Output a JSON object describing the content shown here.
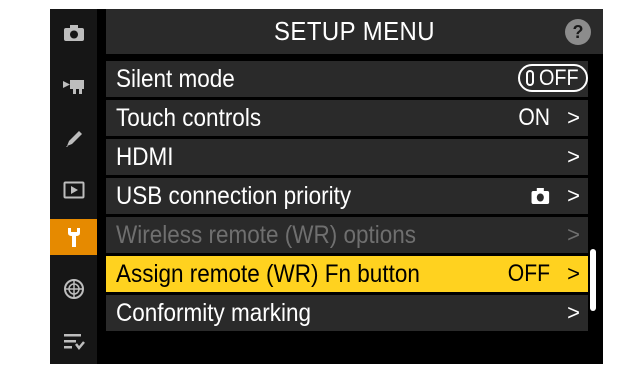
{
  "header": {
    "title": "SETUP MENU",
    "help": "?"
  },
  "sidebar": {
    "items": [
      {
        "icon": "camera-icon",
        "active": false
      },
      {
        "icon": "movie-camera-icon",
        "active": false
      },
      {
        "icon": "pencil-icon",
        "active": false
      },
      {
        "icon": "playback-icon",
        "active": false
      },
      {
        "icon": "wrench-icon",
        "active": true
      },
      {
        "icon": "network-icon",
        "active": false
      },
      {
        "icon": "my-menu-icon",
        "active": false
      }
    ]
  },
  "menu": {
    "items": [
      {
        "label": "Silent mode",
        "value": "OFF",
        "type": "toggle"
      },
      {
        "label": "Touch controls",
        "value": "ON",
        "type": "submenu"
      },
      {
        "label": "HDMI",
        "value": "",
        "type": "submenu"
      },
      {
        "label": "USB connection priority",
        "value": "camera-icon",
        "type": "submenu"
      },
      {
        "label": "Wireless remote (WR) options",
        "value": "",
        "type": "submenu",
        "disabled": true
      },
      {
        "label": "Assign remote (WR) Fn button",
        "value": "OFF",
        "type": "submenu",
        "highlighted": true
      },
      {
        "label": "Conformity marking",
        "value": "",
        "type": "submenu"
      }
    ],
    "chevron": ">"
  },
  "colors": {
    "accent": "#e68a00",
    "highlight": "#ffd21f",
    "row": "#2a2a2a",
    "disabled": "#6f6f6f"
  }
}
